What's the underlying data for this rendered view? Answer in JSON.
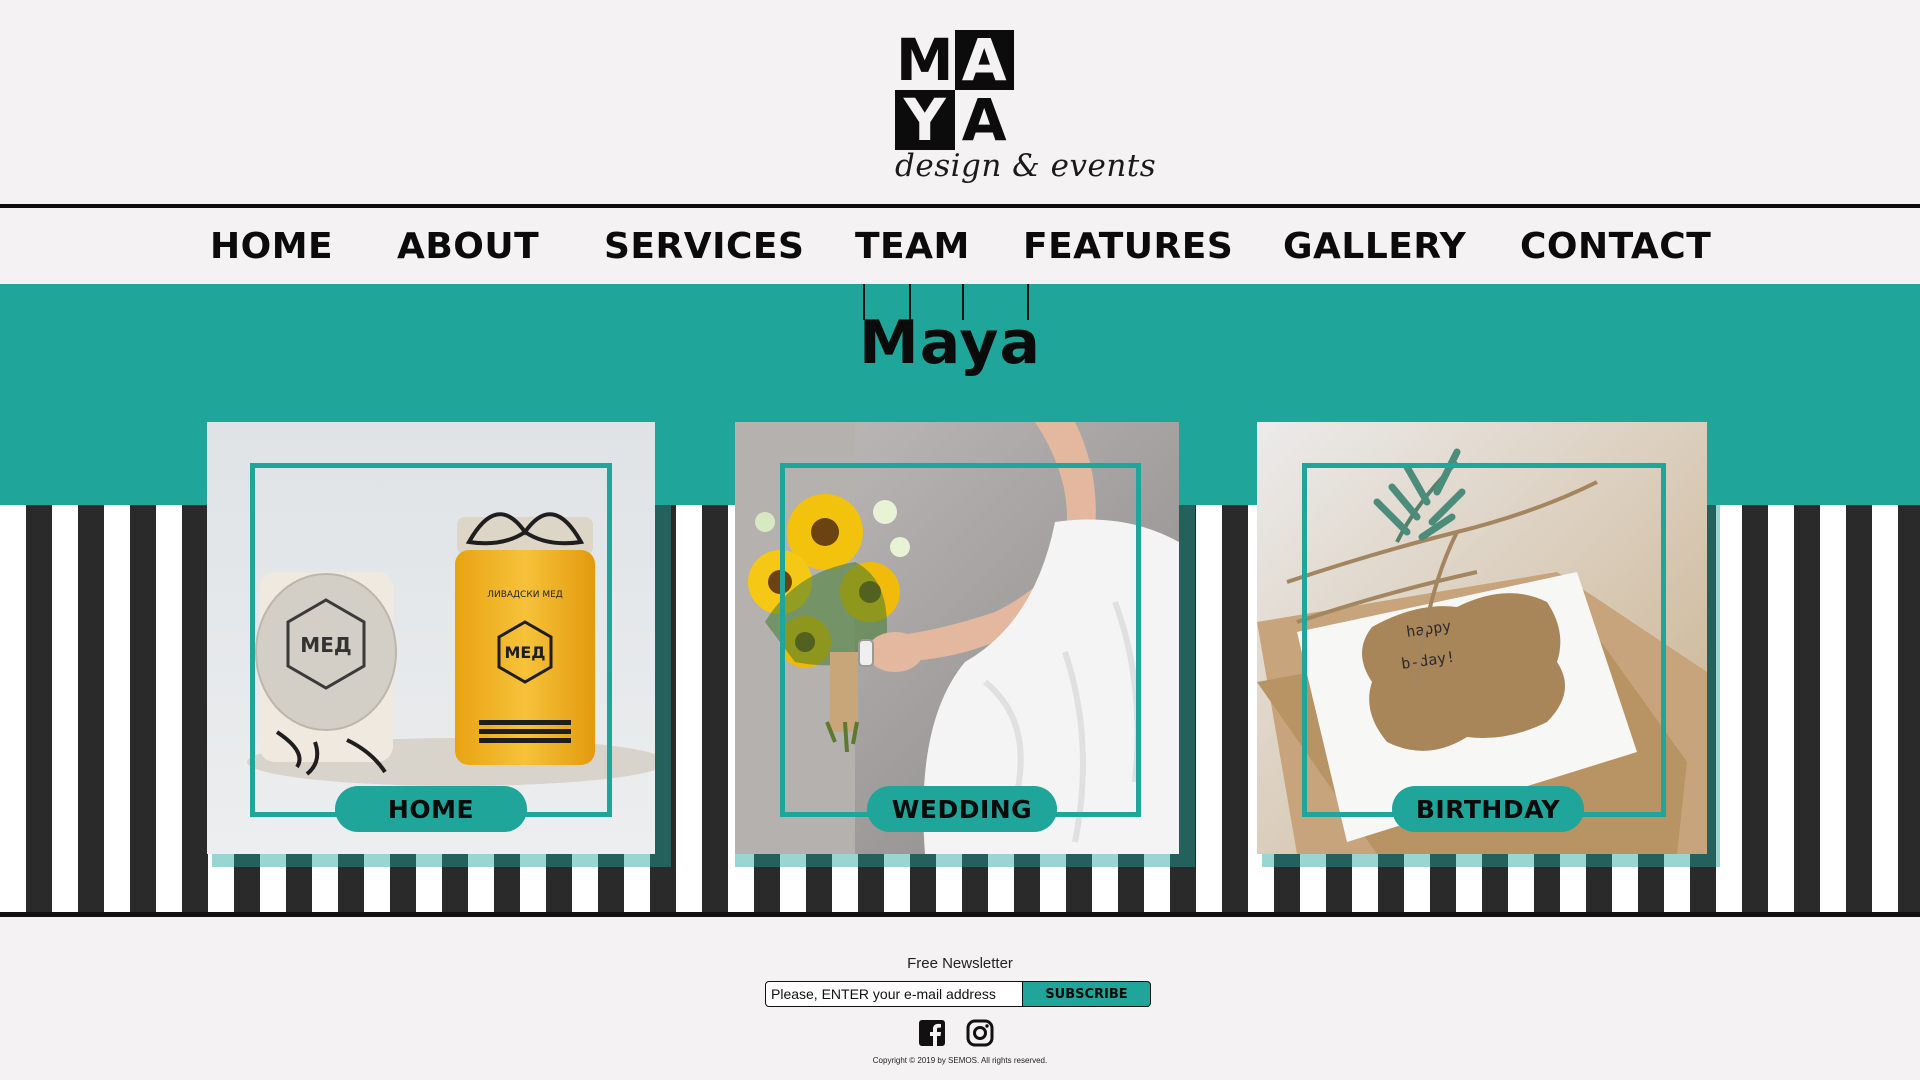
{
  "brand": {
    "logo_letters": [
      "M",
      "A",
      "Y",
      "A"
    ],
    "tagline": "design & events",
    "hero_word": "Maya"
  },
  "nav": {
    "items": [
      {
        "label": "HOME"
      },
      {
        "label": "ABOUT"
      },
      {
        "label": "SERVICES"
      },
      {
        "label": "TEAM"
      },
      {
        "label": "FEATURES"
      },
      {
        "label": "GALLERY"
      },
      {
        "label": "CONTACT"
      }
    ]
  },
  "cards": [
    {
      "label": "HOME",
      "photo": "honey-jars-photo"
    },
    {
      "label": "WEDDING",
      "photo": "bride-bouquet-photo"
    },
    {
      "label": "BIRTHDAY",
      "photo": "birthday-card-photo"
    }
  ],
  "jar": {
    "logo_text": "MEД",
    "label_text": "ЛИВАДСКИ МЕД"
  },
  "birthday_card_text": [
    "happy",
    "b-day!"
  ],
  "newsletter": {
    "title": "Free Newsletter",
    "placeholder": "Please, ENTER your e-mail address",
    "button_label": "SUBSCRIBE"
  },
  "social": {
    "icons": [
      "facebook-icon",
      "instagram-icon"
    ]
  },
  "footer": {
    "copyright": "Copyright © 2019 by SEMOS. All rights reserved."
  },
  "colors": {
    "accent": "#1fa59a",
    "dark": "#0b0b0b",
    "background": "#f4f2f3"
  }
}
